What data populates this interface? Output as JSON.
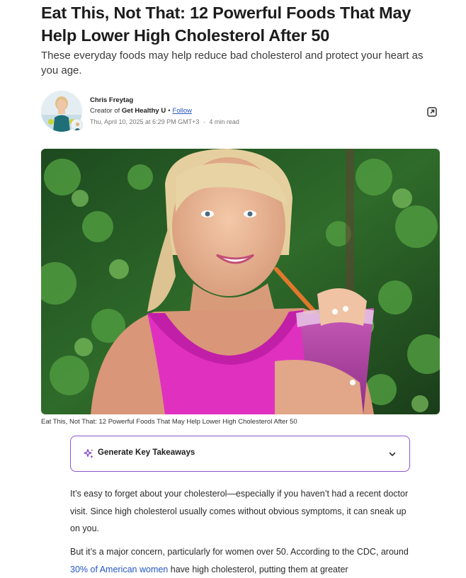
{
  "article": {
    "headline": "Eat This, Not That: 12 Powerful Foods That May Help Lower High Cholesterol After 50",
    "subheadline": "These everyday foods may help reduce bad cholesterol and protect your heart as you age."
  },
  "author": {
    "name": "Chris Freytag",
    "role_prefix": "Creator of",
    "organization": "Get Healthy U",
    "separator": "•",
    "follow_label": "Follow",
    "published": "Thu, April 10, 2025 at 6:29 PM GMT+3",
    "meta_separator": "·",
    "read_time": "4 min read"
  },
  "hero": {
    "caption": "Eat This, Not That: 12 Powerful Foods That May Help Lower High Cholesterol After 50"
  },
  "takeaways": {
    "label": "Generate Key Takeaways"
  },
  "body": {
    "paragraph1": "It’s easy to forget about your cholesterol—especially if you haven’t had a recent doctor visit. Since high cholesterol usually comes without obvious symptoms, it can sneak up on you.",
    "paragraph2_before": "But it’s a major concern, particularly for women over 50. According to the CDC, around ",
    "paragraph2_link": "30% of American women",
    "paragraph2_after": " have high cholesterol, putting them at greater"
  },
  "icons": {
    "share": "share-external-icon",
    "sparkle": "sparkle-icon",
    "chevron": "chevron-down-icon"
  },
  "colors": {
    "link": "#2556c4",
    "takeaways_border": "#8a55c9",
    "sparkle": "#7b3fc4"
  }
}
